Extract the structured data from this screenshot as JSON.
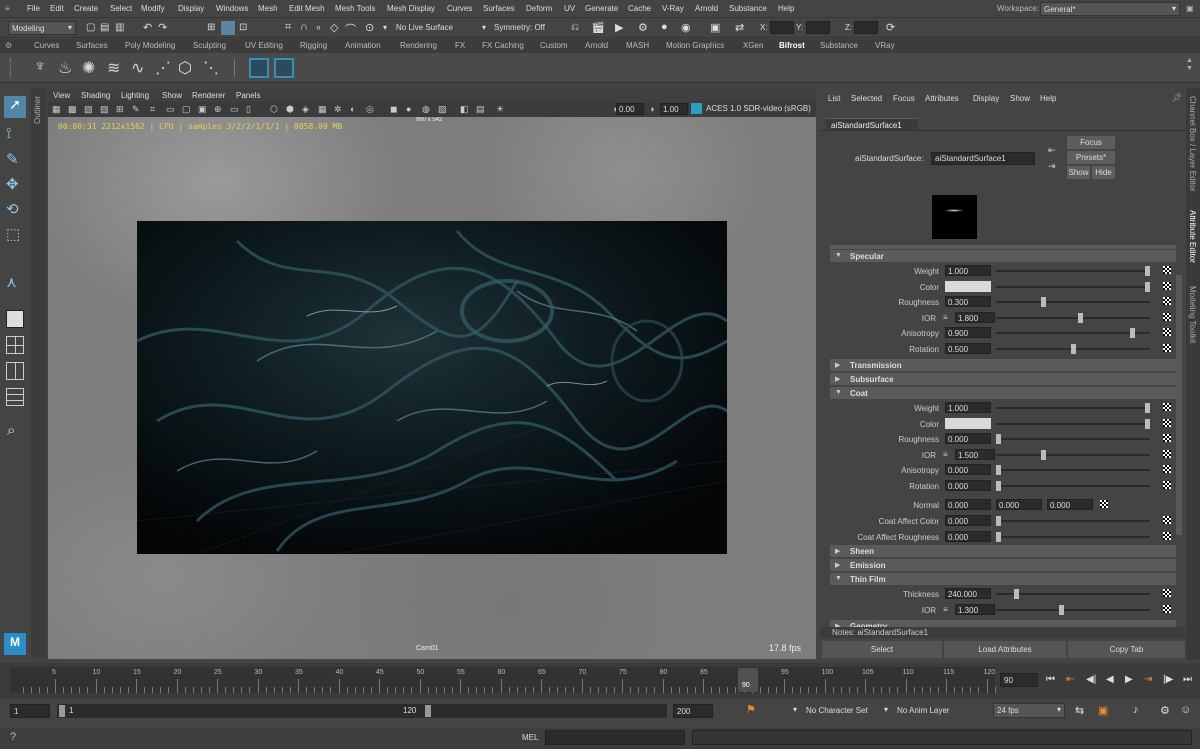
{
  "menubar": {
    "items": [
      "File",
      "Edit",
      "Create",
      "Select",
      "Modify",
      "Display",
      "Windows",
      "Mesh",
      "Edit Mesh",
      "Mesh Tools",
      "Mesh Display",
      "Curves",
      "Surfaces",
      "Deform",
      "UV",
      "Generate",
      "Cache",
      "V-Ray",
      "Arnold",
      "Substance",
      "Help"
    ],
    "workspace_label": "Workspace:",
    "workspace_value": "General*"
  },
  "statusline": {
    "mode": "Modeling",
    "live_surface": "No Live Surface",
    "symmetry": "Symmetry: Off",
    "x_label": "X:",
    "y_label": "Y:",
    "z_label": "Z:"
  },
  "shelf_tabs": [
    "Curves",
    "Surfaces",
    "Poly Modeling",
    "Sculpting",
    "UV Editing",
    "Rigging",
    "Animation",
    "Rendering",
    "FX",
    "FX Caching",
    "Custom",
    "Arnold",
    "MASH",
    "Motion Graphics",
    "XGen",
    "Bifrost",
    "Substance",
    "VRay"
  ],
  "shelf_active_tab": "Bifrost",
  "outliner_label": "Outliner",
  "viewport": {
    "menu": [
      "View",
      "Shading",
      "Lighting",
      "Show",
      "Renderer",
      "Panels"
    ],
    "exposure": "0.00",
    "gamma": "1.00",
    "colorspace": "ACES 1.0 SDR-video (sRGB)",
    "hud_info": "00:00:31 2212x1562 | CPU | samples 3/2/2/1/1/1 | 8058.09 MB",
    "resolution": "960 x 542",
    "camera": "Cam01",
    "fps": "17.8 fps"
  },
  "attr_editor": {
    "menu": [
      "List",
      "Selected",
      "Focus",
      "Attributes",
      "Display",
      "Show",
      "Help"
    ],
    "node_tab": "aiStandardSurface1",
    "type_label": "aiStandardSurface:",
    "node_name": "aiStandardSurface1",
    "focus_btn": "Focus",
    "presets_btn": "Presets*",
    "show_btn": "Show",
    "hide_btn": "Hide",
    "sections": {
      "specular": "Specular",
      "transmission": "Transmission",
      "subsurface": "Subsurface",
      "coat": "Coat",
      "sheen": "Sheen",
      "emission": "Emission",
      "thin_film": "Thin Film",
      "geometry": "Geometry"
    },
    "specular": [
      {
        "label": "Weight",
        "value": "1.000",
        "slider": 1.0
      },
      {
        "label": "Color",
        "value": "",
        "slider": 1.0
      },
      {
        "label": "Roughness",
        "value": "0.300",
        "slider": 0.3
      },
      {
        "label": "IOR",
        "value": "1.800",
        "slider": 0.55
      },
      {
        "label": "Anisotropy",
        "value": "0.900",
        "slider": 0.9
      },
      {
        "label": "Rotation",
        "value": "0.500",
        "slider": 0.5
      }
    ],
    "coat": [
      {
        "label": "Weight",
        "value": "1.000",
        "slider": 1.0
      },
      {
        "label": "Color",
        "value": "",
        "slider": 1.0
      },
      {
        "label": "Roughness",
        "value": "0.000",
        "slider": 0.0
      },
      {
        "label": "IOR",
        "value": "1.500",
        "slider": 0.3
      },
      {
        "label": "Anisotropy",
        "value": "0.000",
        "slider": 0.0
      },
      {
        "label": "Rotation",
        "value": "0.000",
        "slider": 0.0
      }
    ],
    "normal": {
      "label": "Normal",
      "x": "0.000",
      "y": "0.000",
      "z": "0.000"
    },
    "coat_affect": [
      {
        "label": "Coat Affect Color",
        "value": "0.000",
        "slider": 0.0
      },
      {
        "label": "Coat Affect Roughness",
        "value": "0.000",
        "slider": 0.0
      }
    ],
    "thin_film": [
      {
        "label": "Thickness",
        "value": "240.000",
        "slider": 0.12
      },
      {
        "label": "IOR",
        "value": "1.300",
        "slider": 0.42
      }
    ],
    "notes": "Notes:  aiStandardSurface1",
    "select_btn": "Select",
    "load_btn": "Load Attributes",
    "copy_btn": "Copy Tab"
  },
  "side_tabs": [
    "Channel Box / Layer Editor",
    "Attribute Editor",
    "Modeling Toolkit"
  ],
  "timeline": {
    "ticks": [
      "5",
      "10",
      "15",
      "20",
      "25",
      "30",
      "35",
      "40",
      "45",
      "50",
      "55",
      "60",
      "65",
      "70",
      "75",
      "80",
      "85",
      "90",
      "95",
      "100",
      "105",
      "110",
      "115",
      "120"
    ],
    "current_frame_marker": "90",
    "current_frame": "90"
  },
  "range": {
    "start": "1",
    "range_start": "1",
    "range_end": "120",
    "end": "200",
    "character_set": "No Character Set",
    "anim_layer": "No Anim Layer",
    "fps": "24 fps"
  },
  "cmdline": {
    "mode": "MEL"
  }
}
